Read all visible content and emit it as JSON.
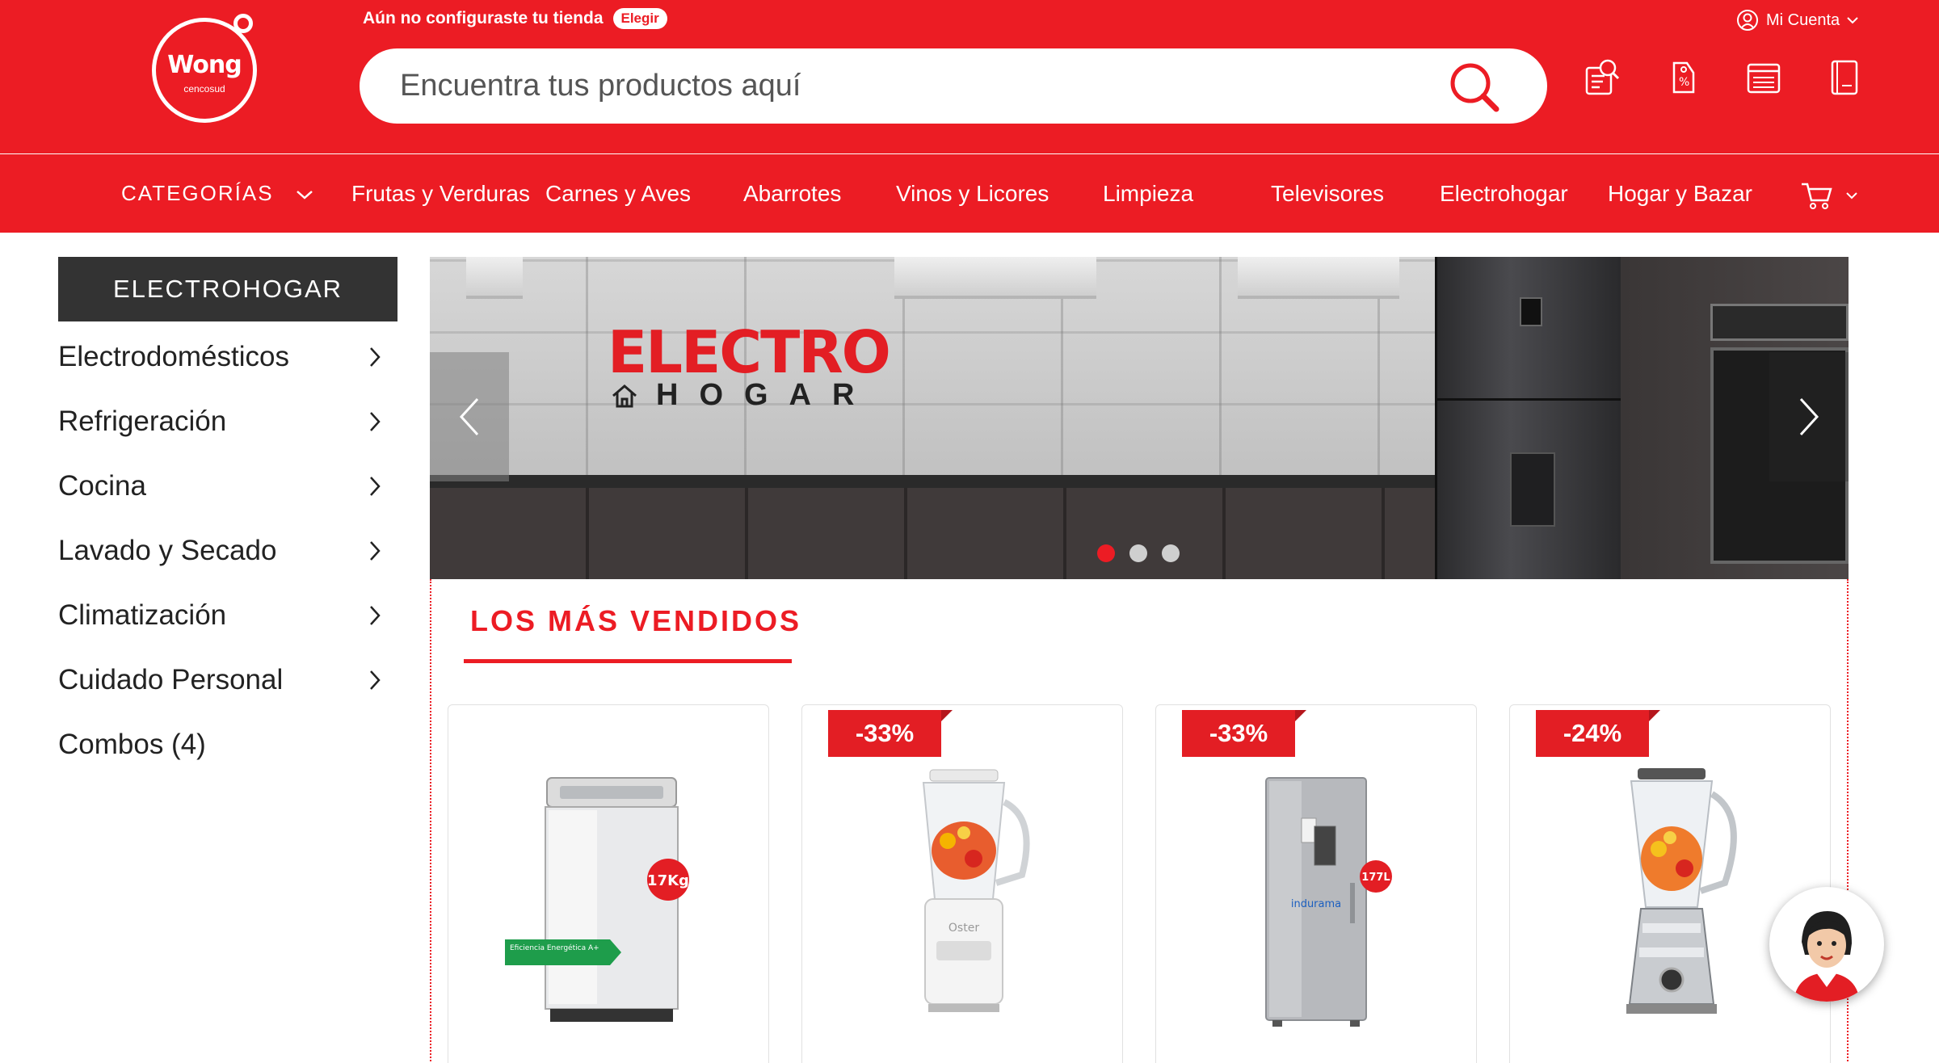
{
  "header": {
    "store_prompt": "Aún no configuraste tu tienda",
    "store_button": "Elegir",
    "account_label": "Mi Cuenta",
    "logo_text": "Wong",
    "logo_sub": "cencosud",
    "search_placeholder": "Encuentra tus productos aquí",
    "icons": [
      "list-search-icon",
      "discount-tag-icon",
      "shopping-list-icon",
      "book-icon"
    ],
    "brand_color": "#ec1c24"
  },
  "nav": {
    "categories_label": "CATEGORÍAS",
    "items": [
      "Frutas y Verduras",
      "Carnes y Aves",
      "Abarrotes",
      "Vinos y Licores",
      "Limpieza",
      "Televisores",
      "Electrohogar",
      "Hogar y Bazar"
    ]
  },
  "sidebar": {
    "title": "ELECTROHOGAR",
    "items": [
      {
        "label": "Electrodomésticos"
      },
      {
        "label": "Refrigeración"
      },
      {
        "label": "Cocina"
      },
      {
        "label": "Lavado y Secado"
      },
      {
        "label": "Climatización"
      },
      {
        "label": "Cuidado Personal"
      },
      {
        "label": "Combos (4)"
      }
    ]
  },
  "banner": {
    "brand_line1": "ELECTRO",
    "brand_line2": "HOGAR",
    "slides": 3,
    "active_slide": 1
  },
  "best_sellers": {
    "title": "LOS MÁS VENDIDOS",
    "products": [
      {
        "image": "washing-machine",
        "badge": "",
        "label": "17Kg",
        "energy": "Eficiencia Energética A+"
      },
      {
        "image": "blender-white",
        "badge": "-33%",
        "label": "Oster"
      },
      {
        "image": "refrigerator",
        "badge": "-33%",
        "label": "177L",
        "brand": "indurama"
      },
      {
        "image": "blender-chrome",
        "badge": "-24%"
      }
    ]
  },
  "chat": {
    "icon": "assistant-avatar-icon"
  }
}
